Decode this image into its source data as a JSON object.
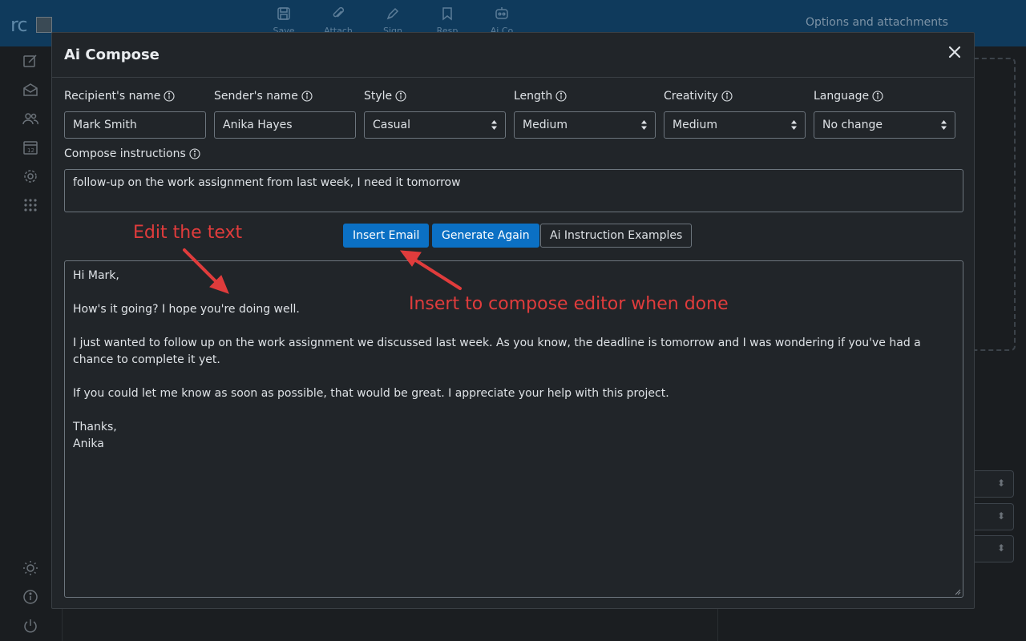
{
  "app": {
    "logo_text": "rc",
    "options_text": "Options and attachments",
    "toolbar": [
      {
        "icon": "save-icon",
        "label": "Save"
      },
      {
        "icon": "paperclip-icon",
        "label": "Attach"
      },
      {
        "icon": "signature-icon",
        "label": "Sign"
      },
      {
        "icon": "bookmark-icon",
        "label": "Resp"
      },
      {
        "icon": "robot-icon",
        "label": "Ai Co"
      }
    ]
  },
  "modal": {
    "title": "Ai Compose",
    "fields": {
      "recipient": {
        "label": "Recipient's name",
        "value": "Mark Smith"
      },
      "sender": {
        "label": "Sender's name",
        "value": "Anika Hayes"
      },
      "style": {
        "label": "Style",
        "value": "Casual"
      },
      "length": {
        "label": "Length",
        "value": "Medium"
      },
      "creativity": {
        "label": "Creativity",
        "value": "Medium"
      },
      "language": {
        "label": "Language",
        "value": "No change"
      }
    },
    "instructions": {
      "label": "Compose instructions",
      "value": "follow-up on the work assignment from last week, I need it tomorrow"
    },
    "buttons": {
      "insert": "Insert Email",
      "generate": "Generate Again",
      "examples": "Ai Instruction Examples"
    },
    "email_lines": [
      "Hi Mark,",
      "",
      "How's it going? I hope you're doing well.",
      "",
      "I just wanted to follow up on the work assignment we discussed last week. As you know, the deadline is tomorrow and I was wondering if you've had a chance to complete it yet.",
      "",
      "If you could let me know as soon as possible, that would be great. I appreciate your help with this project.",
      "",
      "Thanks,",
      "Anika"
    ]
  },
  "annotations": {
    "edit_text": "Edit the text",
    "insert_text": "Insert to compose editor when done"
  },
  "colors": {
    "topbar": "#0f3a5c",
    "primary_button": "#0b70c4",
    "annotation": "#e03c3c",
    "modal_bg": "#212529"
  }
}
